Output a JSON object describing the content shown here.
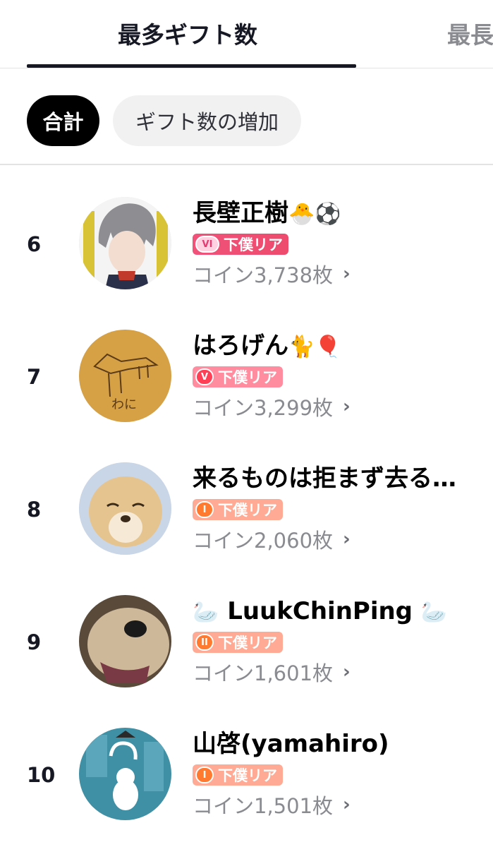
{
  "tabs": [
    {
      "label": "最多ギフト数"
    },
    {
      "label": "最長"
    }
  ],
  "filters": {
    "total": "合計",
    "increase": "ギフト数の増加"
  },
  "ranking": [
    {
      "rank": "6",
      "name": "長壁正樹",
      "emojis": "🐣⚽",
      "badge_emblem": "VI",
      "badge_label": "下僕リア",
      "coins": "コイン3,738枚"
    },
    {
      "rank": "7",
      "name": "はろげん",
      "emojis": "🐈🎈",
      "badge_emblem": "V",
      "badge_label": "下僕リア",
      "coins": "コイン3,299枚"
    },
    {
      "rank": "8",
      "name": "来るものは拒まず去る…",
      "emojis": "",
      "badge_emblem": "I",
      "badge_label": "下僕リア",
      "coins": "コイン2,060枚"
    },
    {
      "rank": "9",
      "name": "LuukChinPing",
      "emojis": "🦢",
      "badge_emblem": "II",
      "badge_label": "下僕リア",
      "coins": "コイン1,601枚"
    },
    {
      "rank": "10",
      "name": "山啓(yamahiro)",
      "emojis": "",
      "badge_emblem": "I",
      "badge_label": "下僕リア",
      "coins": "コイン1,501枚"
    }
  ],
  "icons": {
    "chevron": "chevron-right-icon"
  },
  "colors": {
    "primary_text": "#161823",
    "secondary_text": "#8a8b91",
    "chip_selected_bg": "#000000",
    "chip_unselected_bg": "#f1f1f2"
  }
}
